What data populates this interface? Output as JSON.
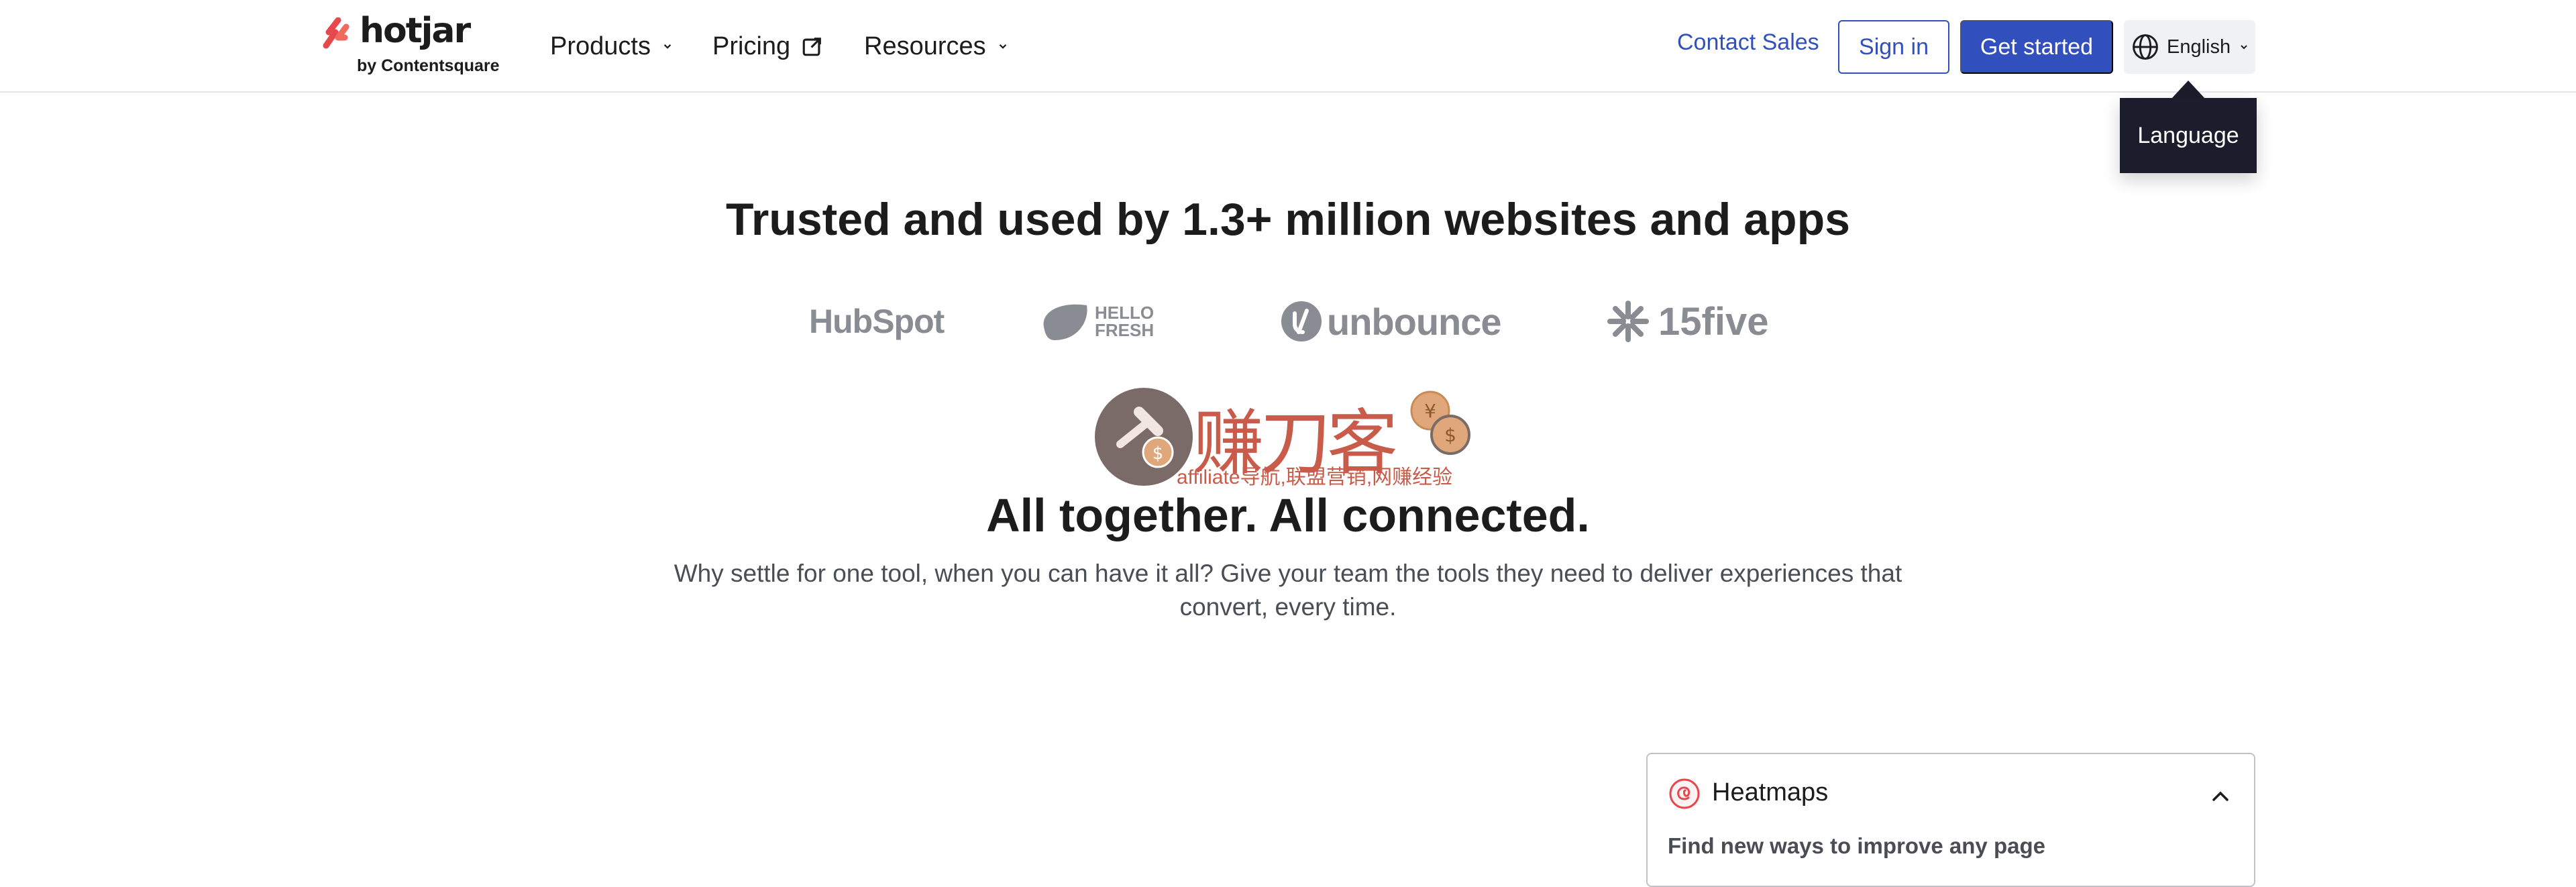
{
  "nav": {
    "logo_text": "hotjar",
    "logo_sub": "by Contentsquare",
    "menu": [
      {
        "label": "Products"
      },
      {
        "label": "Pricing"
      },
      {
        "label": "Resources"
      }
    ],
    "contact": "Contact Sales",
    "sign_in": "Sign in",
    "get_started": "Get started",
    "language": "English",
    "tooltip": "Language"
  },
  "trusted": {
    "title": "Trusted and used by 1.3+ million websites and apps",
    "logos": [
      "HubSpot",
      "HELLO FRESH",
      "unbounce",
      "15five"
    ]
  },
  "watermark": {
    "chinese": "赚刀客",
    "subtitle": "affiliate导航,联盟营销,网赚经验"
  },
  "hero": {
    "headline": "All together. All connected.",
    "subtext": "Why settle for one tool, when you can have it all? Give your team the tools they need to deliver experiences that convert, every time."
  },
  "card": {
    "title": "Heatmaps",
    "description": "Find new ways to improve any page",
    "icon": "heatmap-icon"
  },
  "colors": {
    "brand_blue": "#324fbe",
    "hotjar_red": "#fd3a5c",
    "tooltip_bg": "#1c1c2c"
  }
}
